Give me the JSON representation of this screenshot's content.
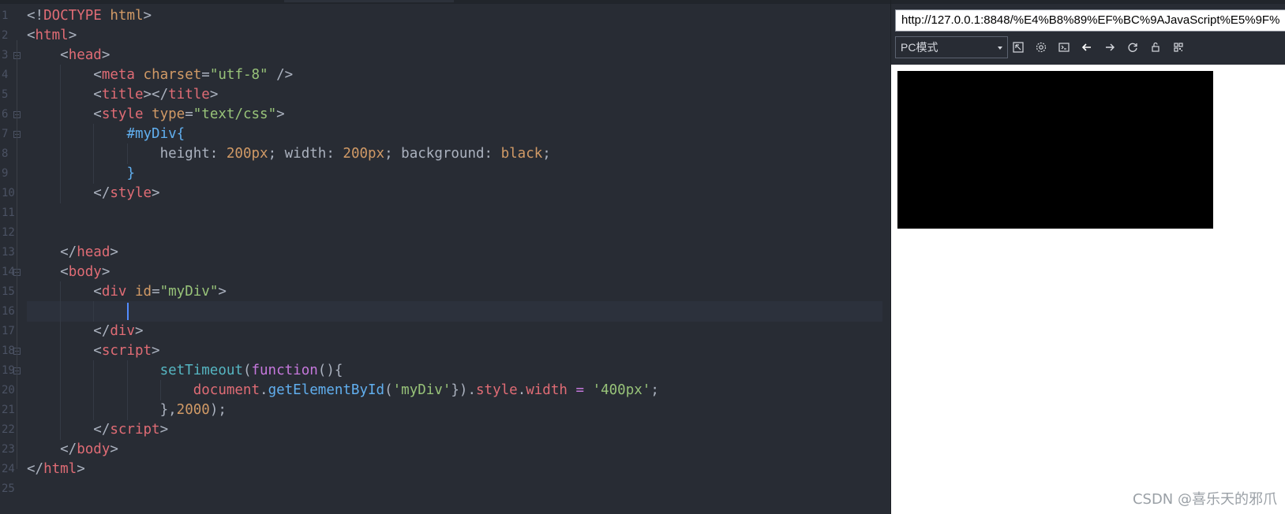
{
  "editor": {
    "line_numbers": [
      "1",
      "2",
      "3",
      "4",
      "5",
      "6",
      "7",
      "8",
      "9",
      "10",
      "11",
      "12",
      "13",
      "14",
      "15",
      "16",
      "17",
      "18",
      "19",
      "20",
      "21",
      "22",
      "23",
      "24",
      "25"
    ],
    "lines": [
      [
        [
          "t-punct",
          "<!"
        ],
        [
          "t-tag",
          "DOCTYPE"
        ],
        [
          "t-punct",
          " "
        ],
        [
          "t-attr",
          "html"
        ],
        [
          "t-punct",
          ">"
        ]
      ],
      [
        [
          "t-punct",
          "<"
        ],
        [
          "t-tag",
          "html"
        ],
        [
          "t-punct",
          ">"
        ]
      ],
      [
        [
          "t-punct",
          "    <"
        ],
        [
          "t-tag",
          "head"
        ],
        [
          "t-punct",
          ">"
        ]
      ],
      [
        [
          "t-punct",
          "        <"
        ],
        [
          "t-tag",
          "meta"
        ],
        [
          "t-punct",
          " "
        ],
        [
          "t-attr",
          "charset"
        ],
        [
          "t-punct",
          "="
        ],
        [
          "t-str",
          "\"utf-8\""
        ],
        [
          "t-punct",
          " />"
        ]
      ],
      [
        [
          "t-punct",
          "        <"
        ],
        [
          "t-tag",
          "title"
        ],
        [
          "t-punct",
          "></"
        ],
        [
          "t-tag",
          "title"
        ],
        [
          "t-punct",
          ">"
        ]
      ],
      [
        [
          "t-punct",
          "        <"
        ],
        [
          "t-tag",
          "style"
        ],
        [
          "t-punct",
          " "
        ],
        [
          "t-attr",
          "type"
        ],
        [
          "t-punct",
          "="
        ],
        [
          "t-str",
          "\"text/css\""
        ],
        [
          "t-punct",
          ">"
        ]
      ],
      [
        [
          "t-punct",
          "            "
        ],
        [
          "t-sel",
          "#myDiv"
        ],
        [
          "t-brace",
          "{"
        ]
      ],
      [
        [
          "t-punct",
          "                "
        ],
        [
          "t-prop",
          "height"
        ],
        [
          "t-punct",
          ": "
        ],
        [
          "t-num",
          "200px"
        ],
        [
          "t-punct",
          "; "
        ],
        [
          "t-prop",
          "width"
        ],
        [
          "t-punct",
          ": "
        ],
        [
          "t-num",
          "200px"
        ],
        [
          "t-punct",
          "; "
        ],
        [
          "t-prop",
          "background"
        ],
        [
          "t-punct",
          ": "
        ],
        [
          "t-val",
          "black"
        ],
        [
          "t-punct",
          ";"
        ]
      ],
      [
        [
          "t-punct",
          "            "
        ],
        [
          "t-brace",
          "}"
        ]
      ],
      [
        [
          "t-punct",
          "        </"
        ],
        [
          "t-tag",
          "style"
        ],
        [
          "t-punct",
          ">"
        ]
      ],
      [],
      [],
      [
        [
          "t-punct",
          "    </"
        ],
        [
          "t-tag",
          "head"
        ],
        [
          "t-punct",
          ">"
        ]
      ],
      [
        [
          "t-punct",
          "    <"
        ],
        [
          "t-tag",
          "body"
        ],
        [
          "t-punct",
          ">"
        ]
      ],
      [
        [
          "t-punct",
          "        <"
        ],
        [
          "t-tag",
          "div"
        ],
        [
          "t-punct",
          " "
        ],
        [
          "t-attr",
          "id"
        ],
        [
          "t-punct",
          "="
        ],
        [
          "t-str",
          "\"myDiv\""
        ],
        [
          "t-punct",
          ">"
        ]
      ],
      [],
      [
        [
          "t-punct",
          "        </"
        ],
        [
          "t-tag",
          "div"
        ],
        [
          "t-punct",
          ">"
        ]
      ],
      [
        [
          "t-punct",
          "        <"
        ],
        [
          "t-tag",
          "script"
        ],
        [
          "t-punct",
          ">"
        ]
      ],
      [
        [
          "t-punct",
          "                "
        ],
        [
          "t-fn",
          "setTimeout"
        ],
        [
          "t-punct",
          "("
        ],
        [
          "t-kw",
          "function"
        ],
        [
          "t-punct",
          "(){"
        ]
      ],
      [
        [
          "t-punct",
          "                    "
        ],
        [
          "t-obj",
          "document"
        ],
        [
          "t-punct",
          "."
        ],
        [
          "t-fn2",
          "getElementById"
        ],
        [
          "t-punct",
          "("
        ],
        [
          "t-str",
          "'myDiv'"
        ],
        [
          "t-punct",
          "})."
        ],
        [
          "t-obj",
          "style"
        ],
        [
          "t-punct",
          "."
        ],
        [
          "t-obj",
          "width"
        ],
        [
          "t-punct",
          " "
        ],
        [
          "t-op",
          "="
        ],
        [
          "t-punct",
          " "
        ],
        [
          "t-str",
          "'400px'"
        ],
        [
          "t-punct",
          ";"
        ]
      ],
      [
        [
          "t-punct",
          "                },"
        ],
        [
          "t-num",
          "2000"
        ],
        [
          "t-punct",
          ");"
        ]
      ],
      [
        [
          "t-punct",
          "        </"
        ],
        [
          "t-tag",
          "script"
        ],
        [
          "t-punct",
          ">"
        ]
      ],
      [
        [
          "t-punct",
          "    </"
        ],
        [
          "t-tag",
          "body"
        ],
        [
          "t-punct",
          ">"
        ]
      ],
      [
        [
          "t-punct",
          "</"
        ],
        [
          "t-tag",
          "html"
        ],
        [
          "t-punct",
          ">"
        ]
      ],
      []
    ],
    "fold_markers": [
      3,
      6,
      7,
      14,
      18,
      19
    ]
  },
  "preview": {
    "url": "http://127.0.0.1:8848/%E4%B8%89%EF%BC%9AJavaScript%E5%9F%",
    "mode_label": "PC模式",
    "toolbar_icons": [
      "open-external-icon",
      "settings-icon",
      "console-icon",
      "back-arrow-icon",
      "forward-arrow-icon",
      "refresh-icon",
      "unlock-icon",
      "qrcode-icon"
    ],
    "rendered_box_color": "#000000"
  },
  "watermark": "CSDN @喜乐天的邪爪"
}
